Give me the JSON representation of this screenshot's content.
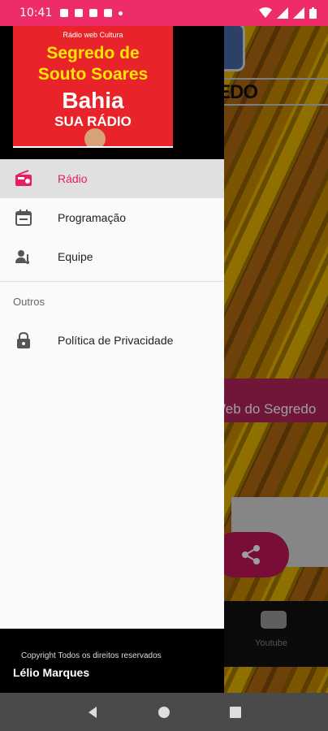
{
  "status_bar": {
    "time": "10:41",
    "color": "#ef2c6a"
  },
  "background_app": {
    "title_fragment": "EDO",
    "banner_line1": ":",
    "banner_line2": "Web do Segredo",
    "youtube_label": "Youtube"
  },
  "drawer": {
    "header": {
      "small_text": "Rádio web Cultura",
      "line1": "Segredo de",
      "line2": "Souto Soares",
      "line3": "Bahia",
      "line4": "SUA RÁDIO"
    },
    "menu_items": [
      {
        "label": "Rádio",
        "icon": "radio-icon",
        "active": true
      },
      {
        "label": "Programação",
        "icon": "calendar-icon",
        "active": false
      },
      {
        "label": "Equipe",
        "icon": "team-icon",
        "active": false
      }
    ],
    "section_title": "Outros",
    "other_items": [
      {
        "label": "Política de Privacidade",
        "icon": "lock-icon"
      }
    ],
    "footer": {
      "copyright": "Copyright Todos os direitos reservados",
      "author": "Lélio Marques"
    }
  },
  "colors": {
    "accent": "#e91e63",
    "drawer_bg": "#fafafa",
    "active_bg": "#e0e0e0"
  }
}
